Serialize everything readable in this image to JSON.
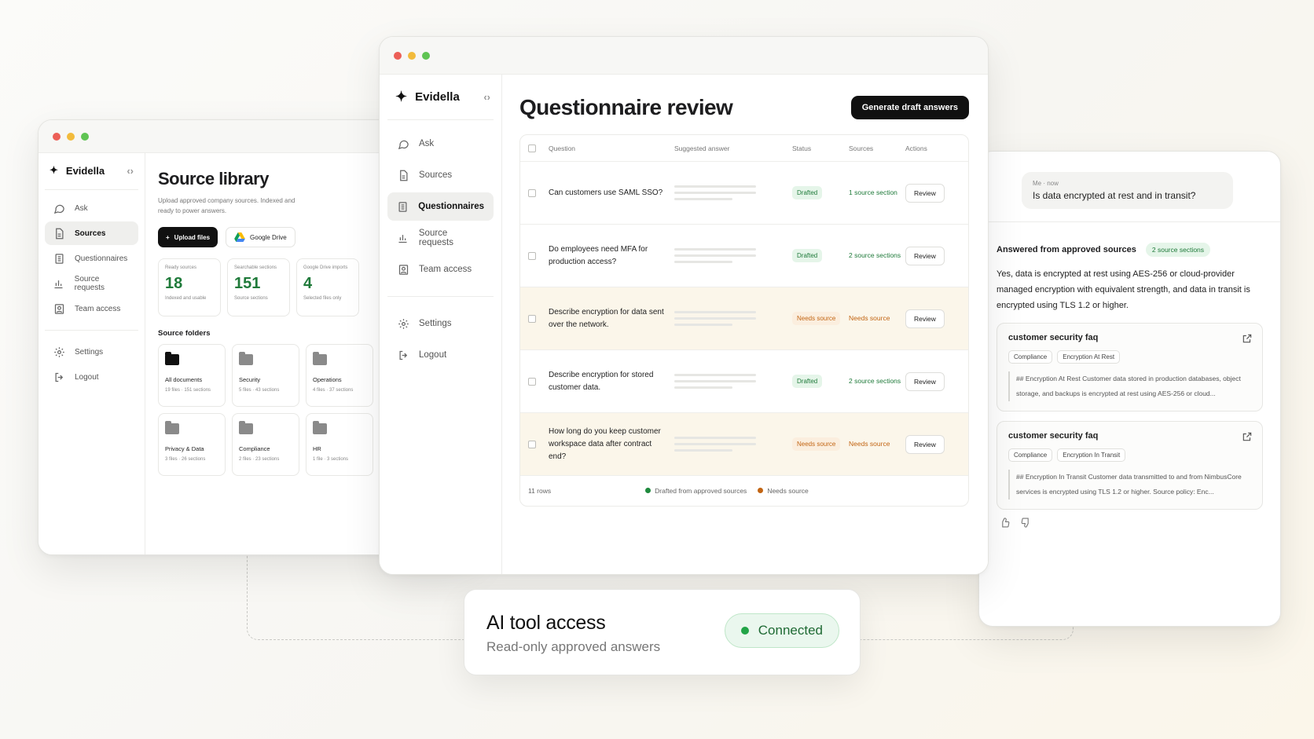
{
  "left_window": {
    "brand": "Evidella",
    "nav": [
      {
        "label": "Ask",
        "icon": "chat-icon"
      },
      {
        "label": "Sources",
        "icon": "document-icon",
        "active": true
      },
      {
        "label": "Questionnaires",
        "icon": "list-icon"
      },
      {
        "label": "Source requests",
        "icon": "bar-chart-icon"
      },
      {
        "label": "Team access",
        "icon": "user-box-icon"
      }
    ],
    "nav_bottom": [
      {
        "label": "Settings",
        "icon": "gear-icon"
      },
      {
        "label": "Logout",
        "icon": "logout-icon"
      }
    ],
    "title": "Source library",
    "subtitle": "Upload approved company sources. Indexed and ready to power answers.",
    "upload_label": "Upload files",
    "drive_label": "Google Drive",
    "stats": [
      {
        "label": "Ready sources",
        "value": "18",
        "sub": "Indexed and usable"
      },
      {
        "label": "Searchable sections",
        "value": "151",
        "sub": "Source sections"
      },
      {
        "label": "Google Drive imports",
        "value": "4",
        "sub": "Selected files only"
      }
    ],
    "folders_title": "Source folders",
    "folders": [
      {
        "name": "All documents",
        "meta": "19 files · 151 sections",
        "dark": true
      },
      {
        "name": "Security",
        "meta": "5 files · 43 sections"
      },
      {
        "name": "Operations",
        "meta": "4 files · 37 sections"
      },
      {
        "name": "Privacy & Data",
        "meta": "3 files · 26 sections"
      },
      {
        "name": "Compliance",
        "meta": "2 files · 23 sections"
      },
      {
        "name": "HR",
        "meta": "1 file · 3 sections"
      }
    ]
  },
  "center_window": {
    "brand": "Evidella",
    "nav": [
      {
        "label": "Ask",
        "icon": "chat-icon"
      },
      {
        "label": "Sources",
        "icon": "document-icon"
      },
      {
        "label": "Questionnaires",
        "icon": "list-icon",
        "active": true
      },
      {
        "label": "Source requests",
        "icon": "bar-chart-icon"
      },
      {
        "label": "Team access",
        "icon": "user-box-icon"
      }
    ],
    "nav_bottom": [
      {
        "label": "Settings",
        "icon": "gear-icon"
      },
      {
        "label": "Logout",
        "icon": "logout-icon"
      }
    ],
    "title": "Questionnaire review",
    "generate_label": "Generate draft answers",
    "columns": [
      "Question",
      "Suggested answer",
      "Status",
      "Sources",
      "Actions"
    ],
    "rows": [
      {
        "question": "Can customers use SAML SSO?",
        "status": "Drafted",
        "sources": "1 source section",
        "warn": false,
        "action": "Review"
      },
      {
        "question": "Do employees need MFA for production access?",
        "status": "Drafted",
        "sources": "2 source sections",
        "warn": false,
        "action": "Review"
      },
      {
        "question": "Describe encryption for data sent over the network.",
        "status": "Needs source",
        "sources": "Needs source",
        "warn": true,
        "action": "Review"
      },
      {
        "question": "Describe encryption for stored customer data.",
        "status": "Drafted",
        "sources": "2 source sections",
        "warn": false,
        "action": "Review"
      },
      {
        "question": "How long do you keep customer workspace data after contract end?",
        "status": "Needs source",
        "sources": "Needs source",
        "warn": true,
        "action": "Review"
      }
    ],
    "row_count": "11 rows",
    "legend": [
      {
        "label": "Drafted from approved sources",
        "color": "#1f8a3e"
      },
      {
        "label": "Needs source",
        "color": "#c26513"
      }
    ]
  },
  "right_panel": {
    "bubble_meta": "Me · now",
    "bubble_text": "Is data encrypted at rest and in transit?",
    "answer_title": "Answered from approved sources",
    "answer_badge": "2 source sections",
    "answer_text": "Yes, data is encrypted at rest using AES-256 or cloud-provider managed encryption with equivalent strength, and data in transit is encrypted using TLS 1.2 or higher.",
    "cards": [
      {
        "title": "customer security faq",
        "tags": [
          "Compliance",
          "Encryption At Rest"
        ],
        "quote": "## Encryption At Rest Customer data stored in production databases, object storage, and backups is encrypted at rest using AES-256 or cloud..."
      },
      {
        "title": "customer security faq",
        "tags": [
          "Compliance",
          "Encryption In Transit"
        ],
        "quote": "## Encryption In Transit Customer data transmitted to and from NimbusCore services is encrypted using TLS 1.2 or higher. Source policy: Enc..."
      }
    ]
  },
  "ai_card": {
    "title": "AI tool access",
    "subtitle": "Read-only approved answers",
    "status": "Connected",
    "status_color": "#22a447"
  }
}
